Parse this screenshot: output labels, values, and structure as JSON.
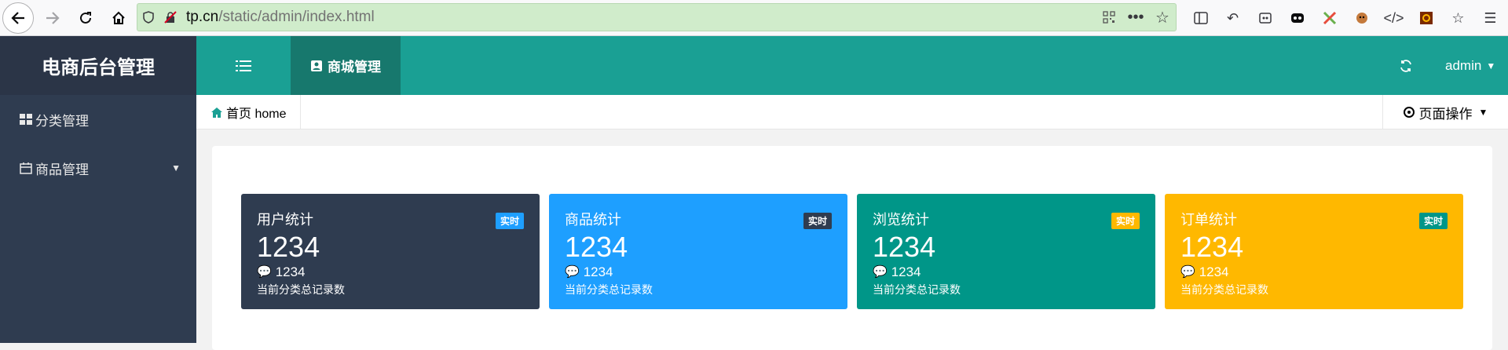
{
  "browser": {
    "url_main": "tp.cn",
    "url_path": "/static/admin/index.html"
  },
  "app": {
    "logo": "电商后台管理",
    "top_tab": "商城管理",
    "user": "admin"
  },
  "sidebar": {
    "items": [
      {
        "label": "分类管理"
      },
      {
        "label": "商品管理"
      }
    ]
  },
  "breadcrumb": {
    "home": "首页 home"
  },
  "page_ops": {
    "label": "页面操作"
  },
  "stats": [
    {
      "title": "用户统计",
      "badge": "实时",
      "value": "1234",
      "sub": "1234",
      "desc": "当前分类总记录数",
      "bg": "#2f3c50",
      "badge_bg": "#1e9fff"
    },
    {
      "title": "商品统计",
      "badge": "实时",
      "value": "1234",
      "sub": "1234",
      "desc": "当前分类总记录数",
      "bg": "#1e9fff",
      "badge_bg": "#2f3c50"
    },
    {
      "title": "浏览统计",
      "badge": "实时",
      "value": "1234",
      "sub": "1234",
      "desc": "当前分类总记录数",
      "bg": "#009688",
      "badge_bg": "#ffb800"
    },
    {
      "title": "订单统计",
      "badge": "实时",
      "value": "1234",
      "sub": "1234",
      "desc": "当前分类总记录数",
      "bg": "#ffb800",
      "badge_bg": "#009688"
    }
  ]
}
